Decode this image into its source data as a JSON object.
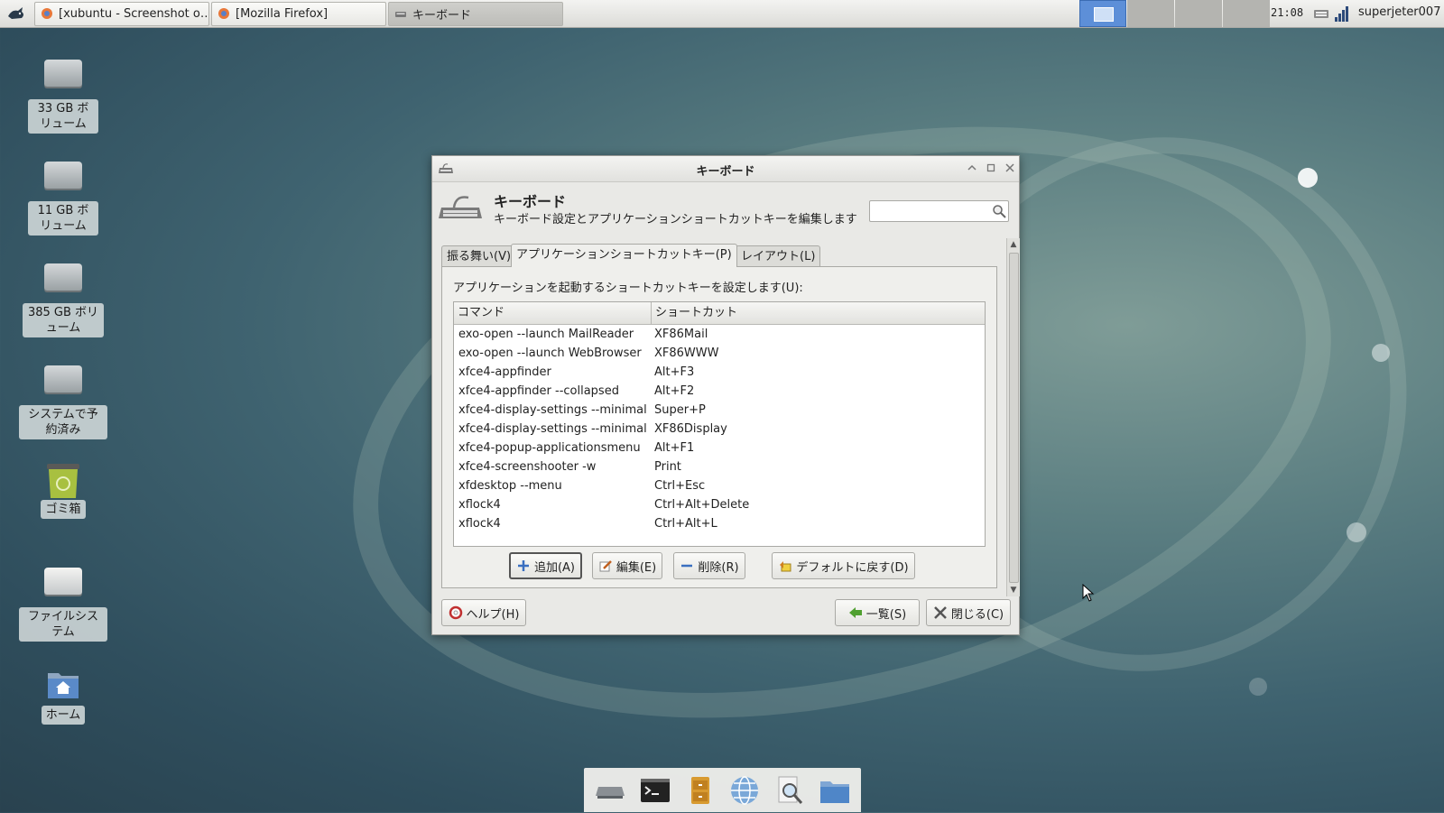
{
  "taskbar": {
    "tasks": [
      {
        "label": "[xubuntu - Screenshot o…"
      },
      {
        "label": "[Mozilla Firefox]"
      },
      {
        "label": "キーボード"
      }
    ],
    "clock": "21:08",
    "user": "superjeter007"
  },
  "desktop": {
    "icons": [
      {
        "label": "33 GB ボリューム",
        "icon": "drive-icon"
      },
      {
        "label": "11 GB ボリューム",
        "icon": "drive-icon"
      },
      {
        "label": "385 GB ボリューム",
        "icon": "drive-icon"
      },
      {
        "label": "システムで予約済み",
        "icon": "drive-icon"
      },
      {
        "label": "ゴミ箱",
        "icon": "trash-icon"
      },
      {
        "label": "ファイルシステム",
        "icon": "drive-icon"
      },
      {
        "label": "ホーム",
        "icon": "home-folder-icon"
      }
    ]
  },
  "window": {
    "title": "キーボード",
    "header_title": "キーボード",
    "header_subtitle": "キーボード設定とアプリケーションショートカットキーを編集します",
    "search_value": "",
    "tabs": [
      {
        "label": "振る舞い(V)"
      },
      {
        "label": "アプリケーションショートカットキー(P)"
      },
      {
        "label": "レイアウト(L)"
      }
    ],
    "panel_label": "アプリケーションを起動するショートカットキーを設定します(U):",
    "columns": {
      "command": "コマンド",
      "shortcut": "ショートカット"
    },
    "rows": [
      {
        "command": "exo-open --launch MailReader",
        "shortcut": "XF86Mail"
      },
      {
        "command": "exo-open --launch WebBrowser",
        "shortcut": "XF86WWW"
      },
      {
        "command": "xfce4-appfinder",
        "shortcut": "Alt+F3"
      },
      {
        "command": "xfce4-appfinder --collapsed",
        "shortcut": "Alt+F2"
      },
      {
        "command": "xfce4-display-settings --minimal",
        "shortcut": "Super+P"
      },
      {
        "command": "xfce4-display-settings --minimal",
        "shortcut": "XF86Display"
      },
      {
        "command": "xfce4-popup-applicationsmenu",
        "shortcut": "Alt+F1"
      },
      {
        "command": "xfce4-screenshooter -w",
        "shortcut": "Print"
      },
      {
        "command": "xfdesktop --menu",
        "shortcut": "Ctrl+Esc"
      },
      {
        "command": "xflock4",
        "shortcut": "Ctrl+Alt+Delete"
      },
      {
        "command": "xflock4",
        "shortcut": "Ctrl+Alt+L"
      }
    ],
    "buttons": {
      "add": "追加(A)",
      "edit": "編集(E)",
      "remove": "削除(R)",
      "reset": "デフォルトに戻す(D)",
      "help": "ヘルプ(H)",
      "all_settings": "一覧(S)",
      "close": "閉じる(C)"
    }
  },
  "dock": {
    "items": [
      "desktop-icon",
      "terminal-icon",
      "file-cabinet-icon",
      "web-browser-icon",
      "search-icon",
      "folder-icon"
    ]
  }
}
